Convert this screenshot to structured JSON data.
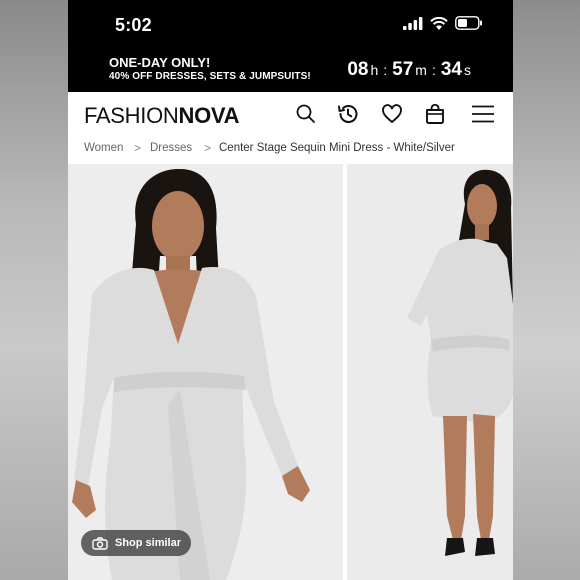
{
  "status_bar": {
    "time": "5:02"
  },
  "promo": {
    "title": "ONE-DAY ONLY!",
    "subtitle": "40% OFF DRESSES, SETS & JUMPSUITS!",
    "countdown": {
      "hours": "08",
      "hours_unit": "h",
      "minutes": "57",
      "minutes_unit": "m",
      "seconds": "34",
      "seconds_unit": "s"
    }
  },
  "header": {
    "logo_light": "FASHION",
    "logo_bold": "NOVA",
    "icons": [
      "search-icon",
      "history-icon",
      "heart-icon",
      "bag-icon",
      "menu-icon"
    ]
  },
  "breadcrumb": {
    "items": [
      "Women",
      "Dresses",
      "Center Stage Sequin Mini Dress - White/Silver"
    ],
    "separator": ">"
  },
  "gallery": {
    "shop_similar_label": "Shop similar"
  },
  "colors": {
    "bar_bg": "#000000",
    "page_bg": "#ffffff",
    "dress": "#dcdcdc",
    "skin": "#b27c5c",
    "hair": "#1a1410"
  }
}
